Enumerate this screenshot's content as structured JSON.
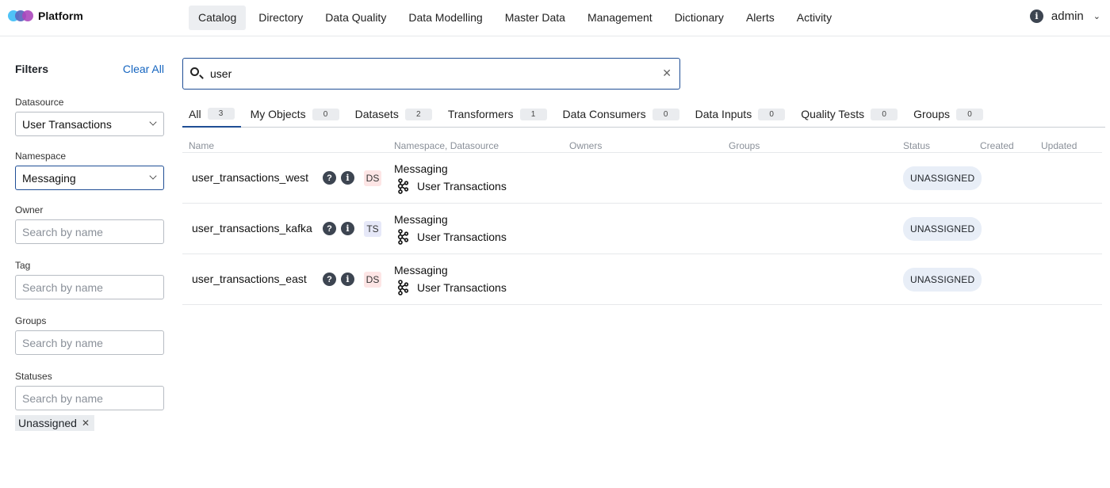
{
  "app": {
    "name": "Platform"
  },
  "nav": {
    "items": [
      "Catalog",
      "Directory",
      "Data Quality",
      "Data Modelling",
      "Master Data",
      "Management",
      "Dictionary",
      "Alerts",
      "Activity"
    ],
    "active": "Catalog",
    "user": "admin"
  },
  "filters": {
    "title": "Filters",
    "clear_all": "Clear All",
    "datasource": {
      "label": "Datasource",
      "value": "User Transactions"
    },
    "namespace": {
      "label": "Namespace",
      "value": "Messaging"
    },
    "owner": {
      "label": "Owner",
      "placeholder": "Search by name"
    },
    "tag": {
      "label": "Tag",
      "placeholder": "Search by name"
    },
    "groups": {
      "label": "Groups",
      "placeholder": "Search by name"
    },
    "statuses": {
      "label": "Statuses",
      "placeholder": "Search by name",
      "chip": "Unassigned"
    }
  },
  "search": {
    "value": "user"
  },
  "tabs": [
    {
      "label": "All",
      "count": "3"
    },
    {
      "label": "My Objects",
      "count": "0"
    },
    {
      "label": "Datasets",
      "count": "2"
    },
    {
      "label": "Transformers",
      "count": "1"
    },
    {
      "label": "Data Consumers",
      "count": "0"
    },
    {
      "label": "Data Inputs",
      "count": "0"
    },
    {
      "label": "Quality Tests",
      "count": "0"
    },
    {
      "label": "Groups",
      "count": "0"
    }
  ],
  "table": {
    "columns": [
      "Name",
      "Namespace, Datasource",
      "Owners",
      "Groups",
      "Status",
      "Created",
      "Updated"
    ],
    "rows": [
      {
        "name": "user_transactions_west",
        "type": "DS",
        "namespace": "Messaging",
        "datasource": "User Transactions",
        "status": "UNASSIGNED"
      },
      {
        "name": "user_transactions_kafka",
        "type": "TS",
        "namespace": "Messaging",
        "datasource": "User Transactions",
        "status": "UNASSIGNED"
      },
      {
        "name": "user_transactions_east",
        "type": "DS",
        "namespace": "Messaging",
        "datasource": "User Transactions",
        "status": "UNASSIGNED"
      }
    ]
  },
  "colors": {
    "accent": "#1f4e95",
    "link": "#1565c0",
    "ds_tag": "#fde5e5",
    "ts_tag": "#e6e8f8",
    "status_pill": "#e8eef7"
  }
}
